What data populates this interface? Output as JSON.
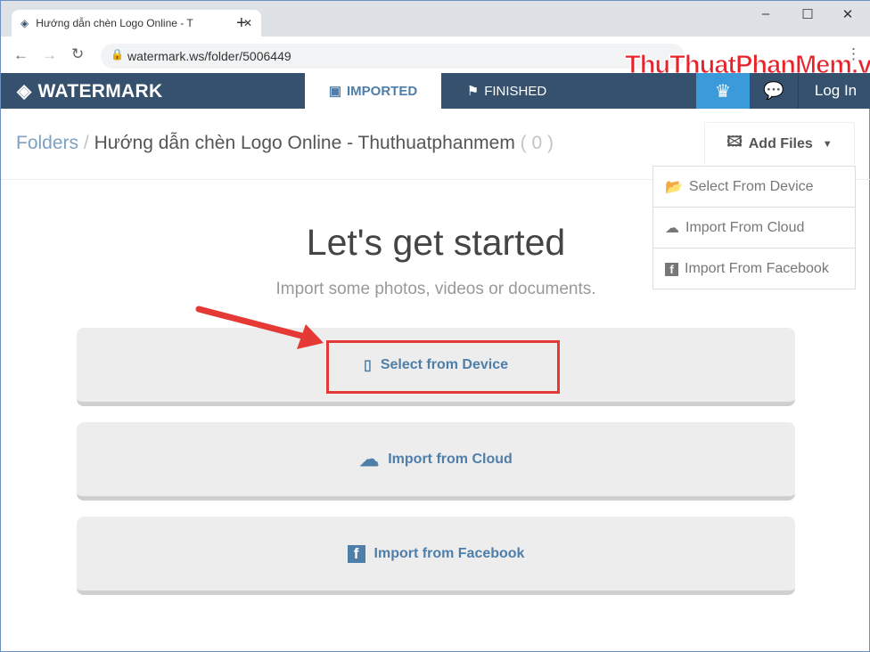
{
  "browser": {
    "tab_title": "Hướng dẫn chèn Logo Online - T",
    "url": "watermark.ws/folder/5006449"
  },
  "app": {
    "logo": "WATERMARK",
    "tabs": [
      {
        "label": "IMPORTED",
        "active": true
      },
      {
        "label": "FINISHED",
        "active": false
      }
    ],
    "login": "Log In",
    "accent": "#3b9ad9",
    "nav_bg": "#36516d"
  },
  "breadcrumb": {
    "root": "Folders",
    "sep": "/",
    "folder": "Hướng dẫn chèn Logo Online - Thuthuatphanmem",
    "count": "( 0 )"
  },
  "add_files": {
    "label": "Add Files",
    "menu": [
      "Select From Device",
      "Import From Cloud",
      "Import From Facebook"
    ]
  },
  "main": {
    "title": "Let's get started",
    "subtitle": "Import some photos, videos or documents.",
    "buttons": [
      "Select from Device",
      "Import from Cloud",
      "Import from Facebook"
    ]
  },
  "watermark_text": "ThuThuatPhanMem.vn"
}
